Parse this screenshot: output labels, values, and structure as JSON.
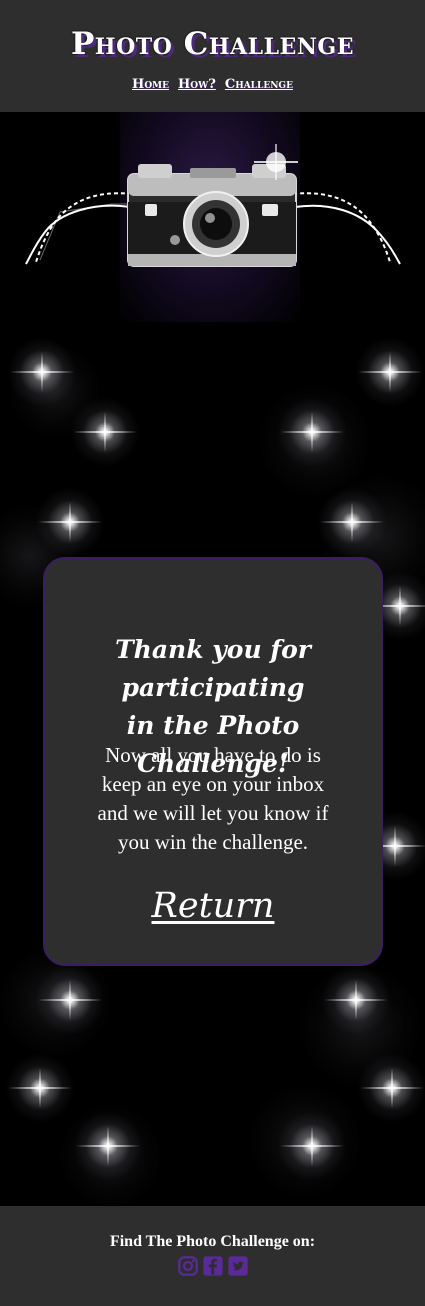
{
  "header": {
    "title": "Photo Challenge",
    "nav": [
      {
        "label": "Home"
      },
      {
        "label": "How?"
      },
      {
        "label": "Challenge"
      }
    ]
  },
  "hero": {
    "image": "vintage-camera-with-film-strip"
  },
  "card": {
    "title_line1": "Thank you for participating",
    "title_line2": "in the Photo Challenge!",
    "body_lines": [
      "Now all you have to do is",
      "keep an eye on your inbox",
      "and we will let you know if",
      "you win the challenge."
    ],
    "return_label": "Return"
  },
  "footer": {
    "text": "Find The Photo Challenge on:",
    "social": [
      {
        "icon": "instagram-icon"
      },
      {
        "icon": "facebook-icon"
      },
      {
        "icon": "twitter-icon"
      }
    ]
  },
  "colors": {
    "panel": "#2f2e2f",
    "accent": "#5b2a9a",
    "card_border": "#3b1d63"
  }
}
